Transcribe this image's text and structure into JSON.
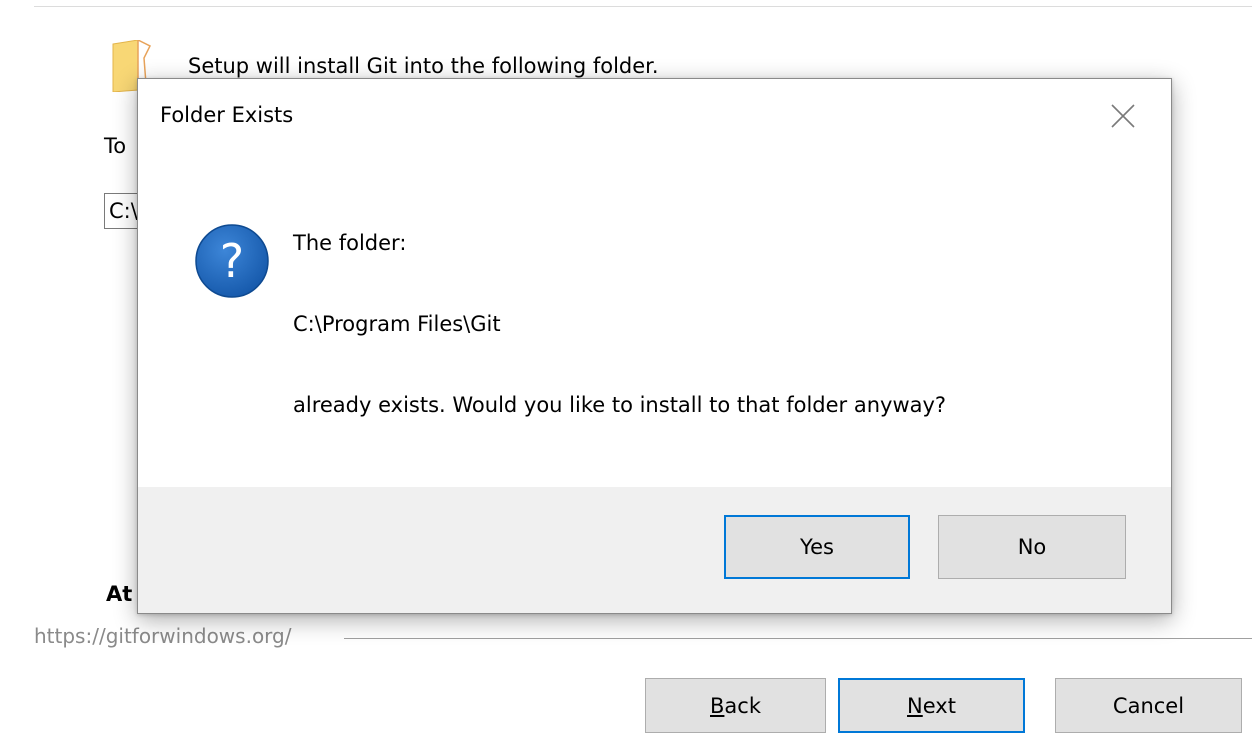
{
  "wizard": {
    "install_message": "Setup will install Git into the following folder.",
    "continue_prefix": "To",
    "path_value": "C:\\",
    "bottom_prefix": "At",
    "footer_link": "https://gitforwindows.org/",
    "buttons": {
      "back_mnemonic": "B",
      "back_rest": "ack",
      "next_mnemonic": "N",
      "next_rest": "ext",
      "cancel": "Cancel"
    }
  },
  "dialog": {
    "title": "Folder Exists",
    "message_line1": "The folder:",
    "message_path": "C:\\Program Files\\Git",
    "message_line3": "already exists. Would you like to install to that folder anyway?",
    "yes_label": "Yes",
    "no_label": "No"
  },
  "icons": {
    "folder": "folder-icon",
    "question": "question-icon",
    "close": "close-icon"
  },
  "colors": {
    "accent_border": "#0078d7",
    "question_blue": "#1a64b8",
    "folder_yellow": "#f8d775"
  }
}
